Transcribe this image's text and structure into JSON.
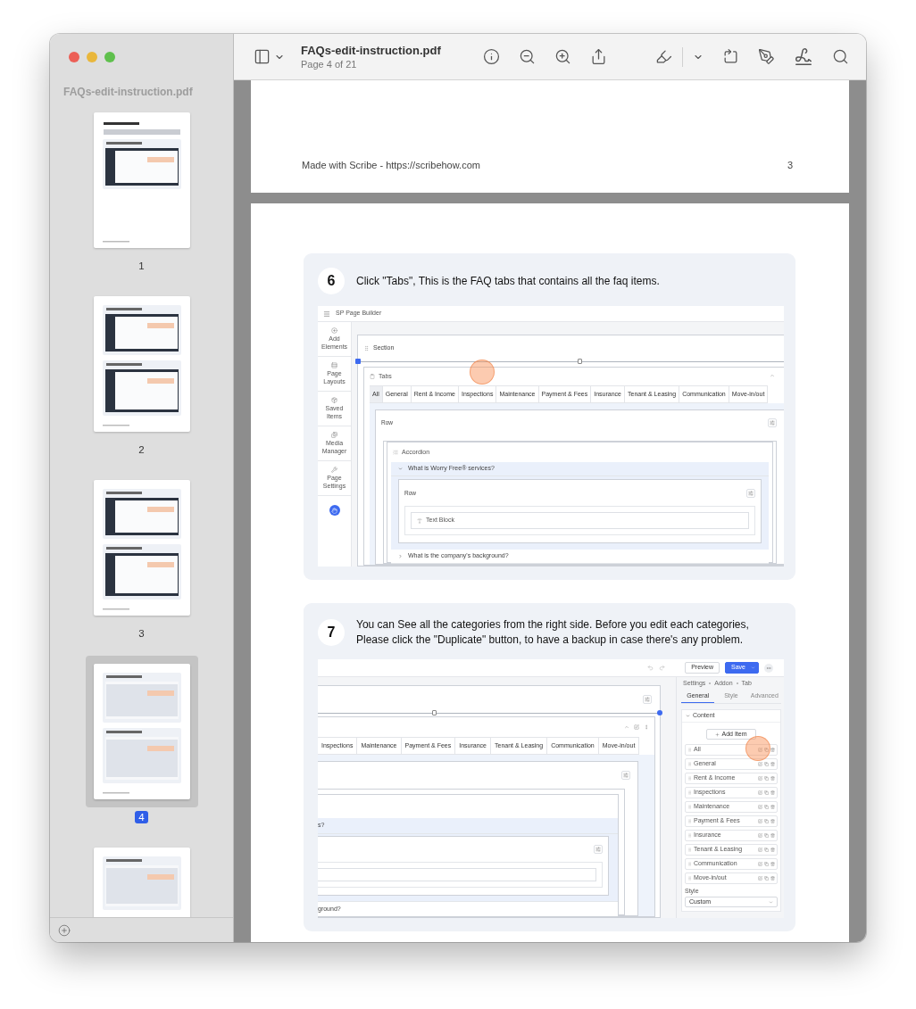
{
  "window": {
    "title": "FAQs-edit-instruction.pdf",
    "subtitle": "Page 4 of 21"
  },
  "sidebar": {
    "title": "FAQs-edit-instruction.pdf",
    "thumbnails": [
      {
        "label": "1",
        "selected": false
      },
      {
        "label": "2",
        "selected": false
      },
      {
        "label": "3",
        "selected": false
      },
      {
        "label": "4",
        "selected": true
      },
      {
        "selected": false
      }
    ]
  },
  "previous_page": {
    "footer_text": "Made with Scribe - https://scribehow.com",
    "page_number": "3"
  },
  "steps": [
    {
      "number": "6",
      "text": "Click \"Tabs\", This is the FAQ tabs that contains all the faq items.",
      "screenshot": {
        "kind": "builder",
        "app_title": "SP Page Builder",
        "rail_items": [
          "Add Elements",
          "Page Layouts",
          "Saved Items",
          "Media Manager",
          "Page Settings"
        ],
        "section_label": "Section",
        "addon_label": "Tabs",
        "tabs": [
          {
            "label": "All",
            "selected": true
          },
          {
            "label": "General",
            "selected": false
          },
          {
            "label": "Rent & Income",
            "selected": false
          },
          {
            "label": "Inspections",
            "selected": false
          },
          {
            "label": "Maintenance",
            "selected": false
          },
          {
            "label": "Payment & Fees",
            "selected": false
          },
          {
            "label": "Insurance",
            "selected": false
          },
          {
            "label": "Tenant & Leasing",
            "selected": false
          },
          {
            "label": "Communication",
            "selected": false
          },
          {
            "label": "Move-in/out",
            "selected": false
          }
        ],
        "row_label": "Row",
        "accordion_label": "Accordion",
        "accordion_items": [
          {
            "title": "What is Worry Free® services?",
            "expanded": true,
            "row_label": "Row",
            "block_label": "Text Block"
          },
          {
            "title": "What is the company's background?",
            "expanded": false
          }
        ]
      }
    },
    {
      "number": "7",
      "text": "You can See all the categories from the right side. Before you edit each categories, Please click the \"Duplicate\" button, to have a backup in case there's any problem.",
      "screenshot": {
        "kind": "settings",
        "preview_label": "Preview",
        "save_label": "Save",
        "tabs": [
          "Inspections",
          "Maintenance",
          "Payment & Fees",
          "Insurance",
          "Tenant & Leasing",
          "Communication",
          "Move-in/out"
        ],
        "accordion_items": [
          {
            "title": "s?",
            "expanded": true
          },
          {
            "title": "ground?",
            "expanded": false
          }
        ],
        "breadcrumb": [
          "Settings",
          "Addon",
          "Tab"
        ],
        "panel_tabs": [
          {
            "label": "General",
            "selected": true
          },
          {
            "label": "Style",
            "selected": false
          },
          {
            "label": "Advanced",
            "selected": false
          }
        ],
        "section_title": "Content",
        "add_item_label": "Add Item",
        "items": [
          "All",
          "General",
          "Rent & Income",
          "Inspections",
          "Maintenance",
          "Payment & Fees",
          "Insurance",
          "Tenant & Leasing",
          "Communication",
          "Move-in/out"
        ],
        "style_label": "Style",
        "style_value": "Custom"
      }
    }
  ]
}
